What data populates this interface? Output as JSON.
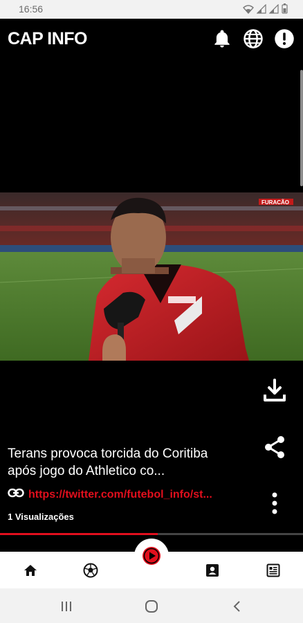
{
  "status_bar": {
    "time": "16:56"
  },
  "header": {
    "title": "CAP INFO",
    "icons": [
      "bell-icon",
      "globe-icon",
      "info-icon"
    ]
  },
  "video": {
    "title_line1": "Terans provoca torcida do Coritiba",
    "title_line2": "após jogo do Athletico co...",
    "link": "https://twitter.com/futebol_info/st...",
    "views": "1 Visualizações",
    "progress": 0.52,
    "overlay_logo": "FURACÃO",
    "actions": [
      "download-icon",
      "share-icon",
      "more-vertical-icon"
    ]
  },
  "bottom_nav": {
    "items": [
      "home-icon",
      "soccer-ball-icon",
      "play-icon",
      "contact-card-icon",
      "news-icon"
    ],
    "accent": "#e10f1d"
  },
  "system_nav": {
    "buttons": [
      "recent-apps-icon",
      "home-circle-icon",
      "back-icon"
    ]
  }
}
